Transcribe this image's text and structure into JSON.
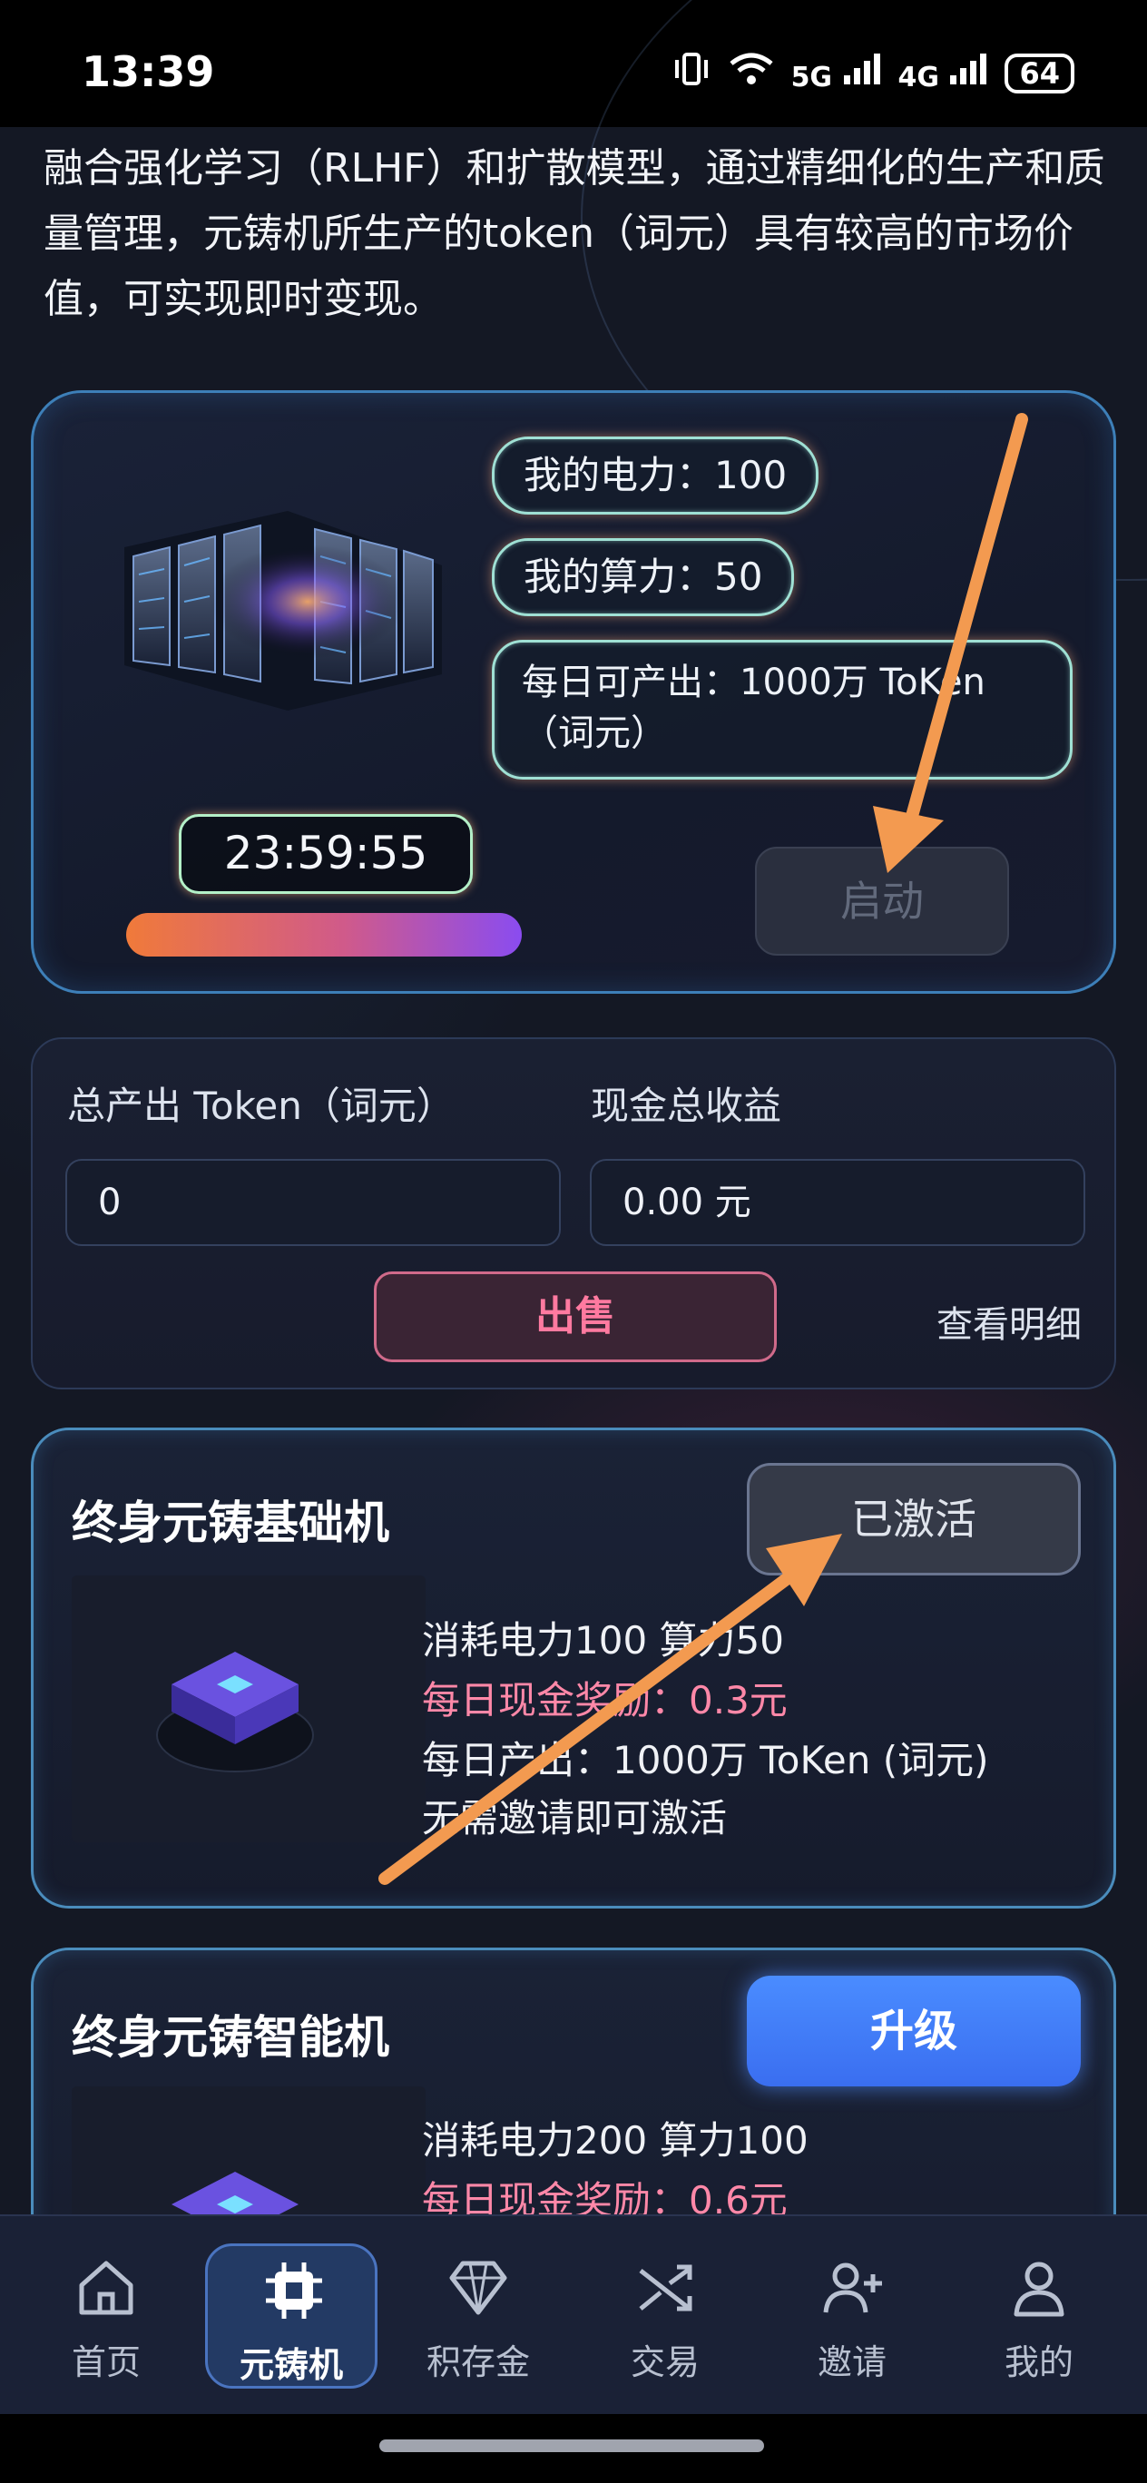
{
  "status_bar": {
    "time": "13:39",
    "network_5g": "5G",
    "network_4g": "4G",
    "battery": "64"
  },
  "intro": {
    "text": "融合强化学习（RLHF）和扩散模型，通过精细化的生产和质量管理，元铸机所生产的token（词元）具有较高的市场价值，可实现即时变现。"
  },
  "machine": {
    "power_label": "我的电力：100",
    "compute_label": "我的算力：50",
    "daily_output": "每日可产出：1000万 ToKen（词元）",
    "timer": "23:59:55",
    "progress": 1.0,
    "start_button": "启动"
  },
  "earnings": {
    "total_token_label": "总产出 Token（词元）",
    "total_token_value": "0",
    "cash_label": "现金总收益",
    "cash_value": "0.00 元",
    "sell_button": "出售",
    "detail_link": "查看明细"
  },
  "tiers": [
    {
      "title": "终身元铸基础机",
      "button": "已激活",
      "consume": "消耗电力100 算力50",
      "cash_reward": "每日现金奖励：0.3元",
      "daily_output": "每日产出：1000万 ToKen (词元)",
      "note": "无需邀请即可激活"
    },
    {
      "title": "终身元铸智能机",
      "button": "升级",
      "consume": "消耗电力200 算力100",
      "cash_reward": "每日现金奖励：0.6元"
    }
  ],
  "nav": {
    "home": "首页",
    "machine": "元铸机",
    "gold": "积存金",
    "trade": "交易",
    "invite": "邀请",
    "mine": "我的"
  },
  "colors": {
    "accent_blue": "#4a8cff",
    "sell_pink": "#ff7aa0",
    "annotation_orange": "#f39a50"
  }
}
